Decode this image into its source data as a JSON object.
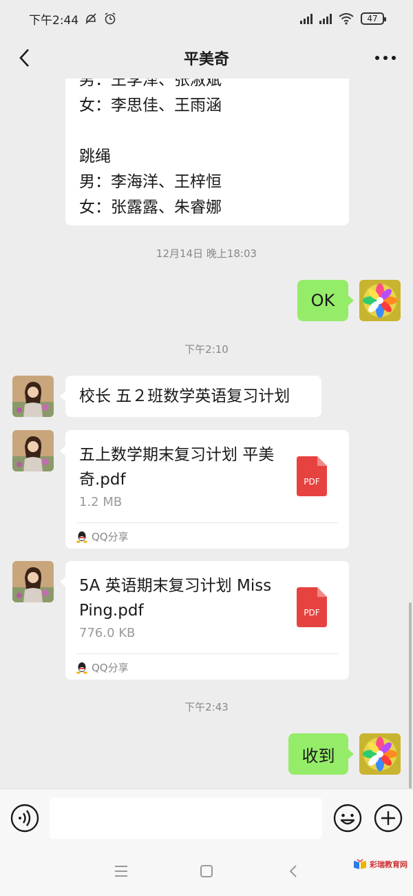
{
  "status_bar": {
    "time": "下午2:44",
    "battery": "47"
  },
  "header": {
    "title": "平美奇"
  },
  "chat": {
    "top_message": {
      "lines": [
        "男：王李泽、张淑斌",
        "女：李思佳、王雨涵",
        "",
        "跳绳",
        "男：李海洋、王梓恒",
        "女：张露露、朱睿娜"
      ]
    },
    "timestamp_1": "12月14日 晚上18:03",
    "reply_ok": "OK",
    "timestamp_2": "下午2:10",
    "text_message": "校长 五２班数学英语复习计划",
    "file_1": {
      "name": "五上数学期末复习计划 平美奇.pdf",
      "size": "1.2 MB",
      "source": "QQ分享",
      "icon_label": "PDF"
    },
    "file_2": {
      "name": "5A 英语期末复习计划 Miss Ping.pdf",
      "size": "776.0 KB",
      "source": "QQ分享",
      "icon_label": "PDF"
    },
    "timestamp_3": "下午2:43",
    "reply_received": "收到"
  },
  "input": {
    "placeholder": ""
  },
  "watermark": {
    "text": "彩瑞教育网"
  },
  "icons": [
    "back-icon",
    "more-icon",
    "voice-icon",
    "emoji-icon",
    "plus-icon",
    "pdf-icon",
    "qq-icon",
    "menu-icon",
    "home-icon",
    "back-nav-icon"
  ],
  "colors": {
    "background": "#ededed",
    "sent_bubble": "#95ec69",
    "received_bubble": "#ffffff",
    "pdf_red": "#e64340"
  }
}
